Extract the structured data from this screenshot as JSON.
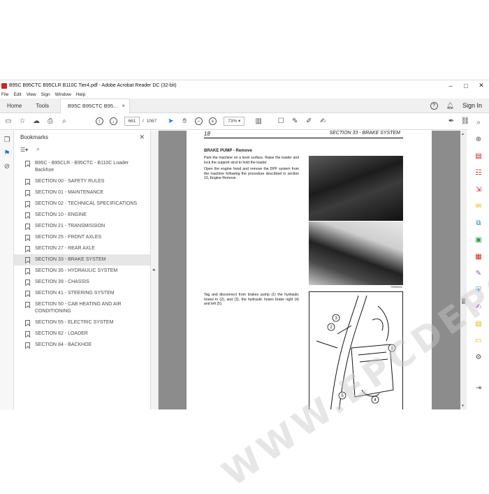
{
  "window": {
    "title": "B95C B95CTC B95CLR B110C Tier4.pdf - Adobe Acrobat Reader DC (32-bit)",
    "minimize": "–",
    "maximize": "□",
    "close": "✕"
  },
  "menu": [
    "File",
    "Edit",
    "View",
    "Sign",
    "Window",
    "Help"
  ],
  "tabs": {
    "home": "Home",
    "tools": "Tools",
    "document": "B95C B95CTC B95...",
    "close": "×",
    "sign_in": "Sign In",
    "help": "?"
  },
  "toolbar": {
    "current_page": "661",
    "page_separator": "/",
    "total_pages": "1067",
    "zoom": "73%"
  },
  "bookmarks": {
    "title": "Bookmarks",
    "close": "✕",
    "items": [
      "B95C - B95CLR - B95CTC - B110C Loader Backhoe",
      "SECTION 00 - SAFETY RULES",
      "SECTION 01 - MAINTENANCE",
      "SECTION 02 - TECHNICAL SPECIFICATIONS",
      "SECTION 10 - ENGINE",
      "SECTION 21 - TRANSMISSION",
      "SECTION 25 - FRONT AXLES",
      "SECTION 27 - REAR AXLE",
      "SECTION 33 - BRAKE SYSTEM",
      "SECTION 35 - HYDRAULIC SYSTEM",
      "SECTION 39 - CHASSIS",
      "SECTION 41 - STEERING SYSTEM",
      "SECTION 50 - CAB HEATING AND AIR CONDITIONING",
      "SECTION 55 - ELECTRIC SYSTEM",
      "SECTION 82 - LOADER",
      "SECTION 84 - BACKHOE"
    ],
    "selected_index": 8
  },
  "page": {
    "number": "18",
    "section": "SECTION 33 - BRAKE SYSTEM",
    "heading": "BRAKE PUMP - Remove",
    "para1": "Park the machine on a level surface. Raise the loader and lock the support strut to hold the loader.",
    "para2": "Open the engine hood and remove the DPF system from the machine following the procedure described in section 10, Engine Remove.",
    "para3": "Tag and disconnect from brakes pump (1) the hydraulic hoses in (2), and (3), the hydraulic hoses brake right (4) and left (5).",
    "photo_caption": "TSR60094",
    "callouts": [
      "1",
      "2",
      "3",
      "4",
      "5"
    ]
  },
  "watermark": "WWW.EPCDEPOT.COM",
  "colors": {
    "accent": "#1473e6",
    "viewer_bg": "#8c8c8c",
    "pdf_red": "#d4211f"
  }
}
